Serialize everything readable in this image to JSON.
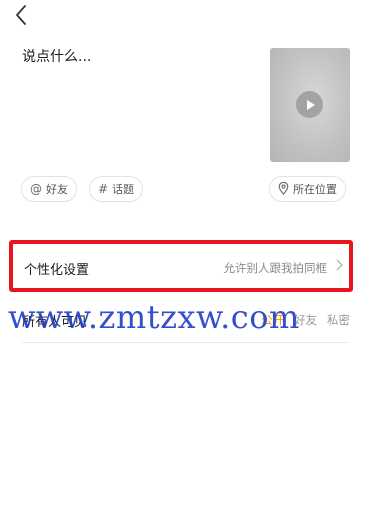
{
  "header": {
    "back_icon": "chevron-left-icon"
  },
  "post": {
    "caption_placeholder": "说点什么...",
    "thumbnail_icon": "play-icon"
  },
  "chips": [
    {
      "icon": "@",
      "label": "好友"
    },
    {
      "icon": "#",
      "label": "话题"
    },
    {
      "icon": "location-pin-icon",
      "label": "所在位置"
    }
  ],
  "personalization": {
    "label": "个性化设置",
    "value": "允许别人跟我拍同框",
    "arrow_icon": "chevron-right-icon",
    "highlight_color": "#e8141e"
  },
  "visibility": {
    "label": "所有人可见",
    "options": [
      "公开",
      "好友",
      "私密"
    ],
    "selected": "公开",
    "accent_color": "#f0a000"
  },
  "watermark": {
    "text": "www.zmtzxw.com"
  }
}
